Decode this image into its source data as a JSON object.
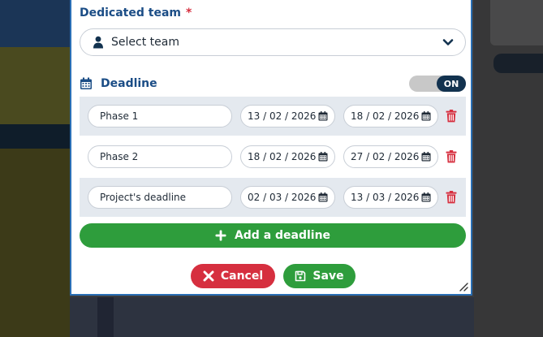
{
  "colors": {
    "label_blue": "#1b4d86",
    "required_red": "#d62f3f",
    "success_green": "#2e9d3c",
    "danger_red": "#d62f3f",
    "toggle_on_bg": "#12324f",
    "row_shade": "#e4e9ef"
  },
  "team": {
    "label": "Dedicated team",
    "required_mark": "*",
    "select_value": "Select team",
    "icons": {
      "user": "user-icon",
      "chevron": "chevron-down-icon"
    }
  },
  "deadline": {
    "label": "Deadline",
    "icon": "calendar-icon",
    "toggle_label": "ON",
    "toggle_on": true
  },
  "phases": [
    {
      "name": "Phase 1",
      "start": "13 / 02 / 2026",
      "end": "18 / 02 / 2026"
    },
    {
      "name": "Phase 2",
      "start": "18 / 02 / 2026",
      "end": "27 / 02 / 2026"
    },
    {
      "name": "Project's deadline",
      "start": "02 / 03 / 2026",
      "end": "13 / 03 / 2026"
    }
  ],
  "actions": {
    "add_deadline": "Add a deadline",
    "cancel": "Cancel",
    "save": "Save",
    "icons": {
      "add": "plus-icon",
      "cancel": "close-icon",
      "save": "save-icon",
      "delete": "trash-icon"
    }
  }
}
